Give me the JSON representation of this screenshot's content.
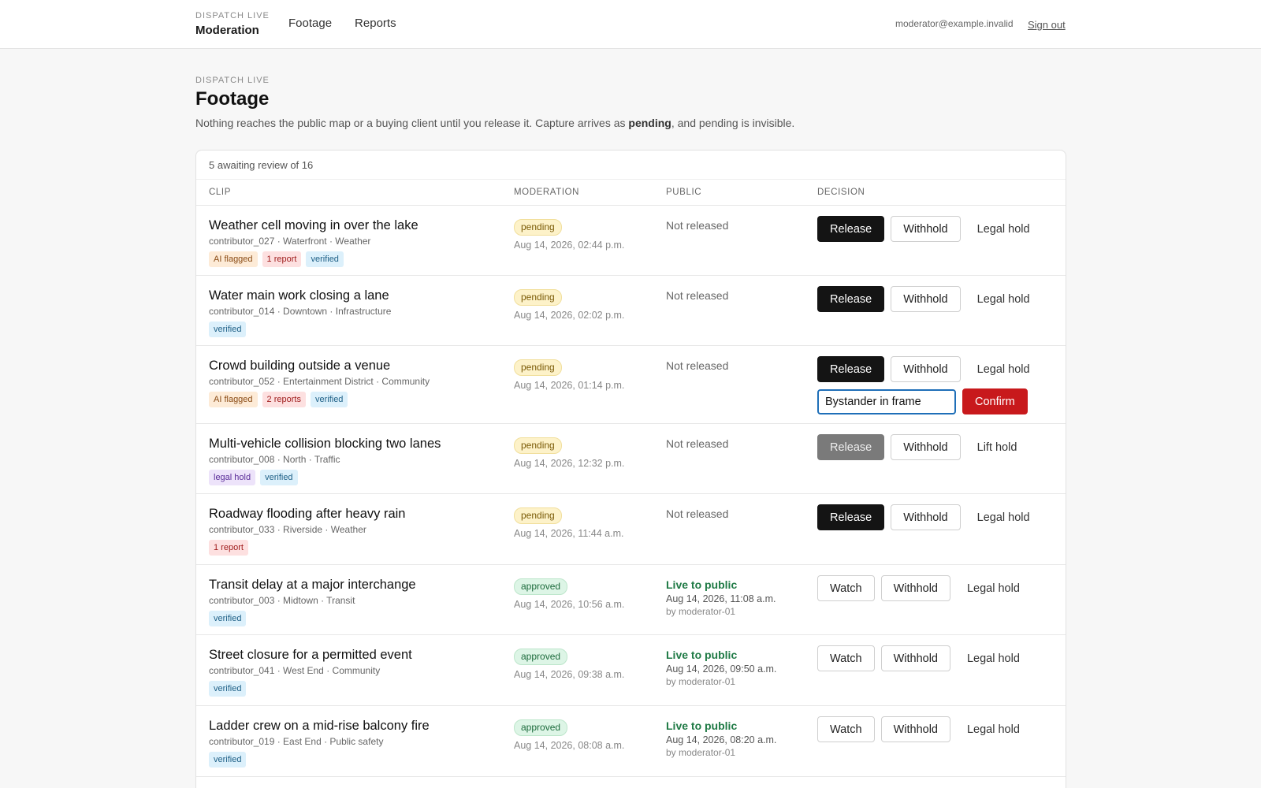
{
  "topbar": {
    "brand_kicker": "DISPATCH LIVE",
    "brand_title": "Moderation",
    "nav": [
      "Footage",
      "Reports"
    ],
    "user_email": "moderator@example.invalid",
    "sign_out": "Sign out"
  },
  "page": {
    "kicker": "DISPATCH LIVE",
    "title": "Footage",
    "intro_before": "Nothing reaches the public map or a buying client until you release it. Capture arrives as ",
    "intro_bold": "pending",
    "intro_after": ", and pending is invisible."
  },
  "table": {
    "summary": "5 awaiting review of 16",
    "headers": [
      "CLIP",
      "MODERATION",
      "PUBLIC",
      "DECISION"
    ]
  },
  "rows": [
    {
      "title": "Weather cell moving in over the lake",
      "meta": "contributor_027 · Waterfront · Weather",
      "tags": [
        {
          "label": "AI flagged",
          "kind": "ai"
        },
        {
          "label": "1 report",
          "kind": "rep"
        },
        {
          "label": "verified",
          "kind": "ver"
        }
      ],
      "status": "pending",
      "mod_time": "Aug 14, 2026, 02:44 p.m.",
      "public": "Not released",
      "actions": [
        "Release",
        "Withhold",
        "Legal hold"
      ]
    },
    {
      "title": "Water main work closing a lane",
      "meta": "contributor_014 · Downtown · Infrastructure",
      "tags": [
        {
          "label": "verified",
          "kind": "ver"
        }
      ],
      "status": "pending",
      "mod_time": "Aug 14, 2026, 02:02 p.m.",
      "public": "Not released",
      "actions": [
        "Release",
        "Withhold",
        "Legal hold"
      ]
    },
    {
      "title": "Crowd building outside a venue",
      "meta": "contributor_052 · Entertainment District · Community",
      "tags": [
        {
          "label": "AI flagged",
          "kind": "ai"
        },
        {
          "label": "2 reports",
          "kind": "rep"
        },
        {
          "label": "verified",
          "kind": "ver"
        }
      ],
      "status": "pending",
      "mod_time": "Aug 14, 2026, 01:14 p.m.",
      "public": "Not released",
      "actions": [
        "Release",
        "Withhold",
        "Legal hold"
      ],
      "withhold_reason": "Bystander in frame",
      "confirm": "Confirm"
    },
    {
      "title": "Multi-vehicle collision blocking two lanes",
      "meta": "contributor_008 · North · Traffic",
      "tags": [
        {
          "label": "legal hold",
          "kind": "hold"
        },
        {
          "label": "verified",
          "kind": "ver"
        }
      ],
      "status": "pending",
      "mod_time": "Aug 14, 2026, 12:32 p.m.",
      "public": "Not released",
      "actions": [
        "Release",
        "Withhold",
        "Lift hold"
      ],
      "release_disabled": true
    },
    {
      "title": "Roadway flooding after heavy rain",
      "meta": "contributor_033 · Riverside · Weather",
      "tags": [
        {
          "label": "1 report",
          "kind": "rep"
        }
      ],
      "status": "pending",
      "mod_time": "Aug 14, 2026, 11:44 a.m.",
      "public": "Not released",
      "actions": [
        "Release",
        "Withhold",
        "Legal hold"
      ]
    },
    {
      "title": "Transit delay at a major interchange",
      "meta": "contributor_003 · Midtown · Transit",
      "tags": [
        {
          "label": "verified",
          "kind": "ver"
        }
      ],
      "status": "approved",
      "mod_time": "Aug 14, 2026, 10:56 a.m.",
      "public": "Live to public",
      "public_time": "Aug 14, 2026, 11:08 a.m.",
      "public_by": "by moderator-01",
      "actions": [
        "Watch",
        "Withhold",
        "Legal hold"
      ]
    },
    {
      "title": "Street closure for a permitted event",
      "meta": "contributor_041 · West End · Community",
      "tags": [
        {
          "label": "verified",
          "kind": "ver"
        }
      ],
      "status": "approved",
      "mod_time": "Aug 14, 2026, 09:38 a.m.",
      "public": "Live to public",
      "public_time": "Aug 14, 2026, 09:50 a.m.",
      "public_by": "by moderator-01",
      "actions": [
        "Watch",
        "Withhold",
        "Legal hold"
      ]
    },
    {
      "title": "Ladder crew on a mid-rise balcony fire",
      "meta": "contributor_019 · East End · Public safety",
      "tags": [
        {
          "label": "verified",
          "kind": "ver"
        }
      ],
      "status": "approved",
      "mod_time": "Aug 14, 2026, 08:08 a.m.",
      "public": "Live to public",
      "public_time": "Aug 14, 2026, 08:20 a.m.",
      "public_by": "by moderator-01",
      "actions": [
        "Watch",
        "Withhold",
        "Legal hold"
      ]
    }
  ]
}
